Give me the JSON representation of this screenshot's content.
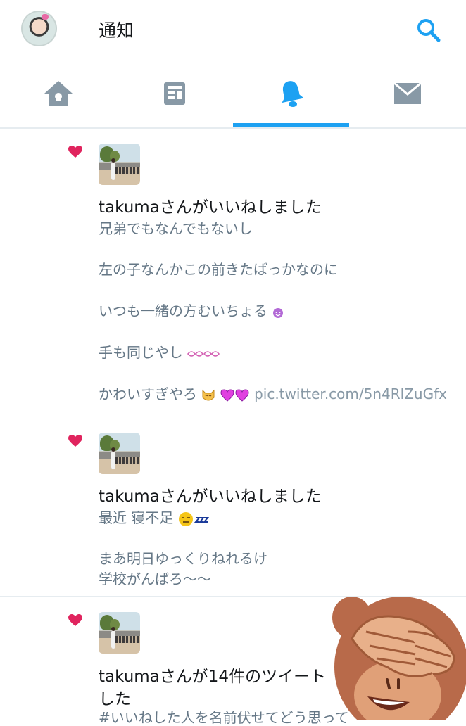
{
  "header": {
    "title": "通知"
  },
  "tabs": [
    {
      "name": "home"
    },
    {
      "name": "moments"
    },
    {
      "name": "notifications",
      "active": true
    },
    {
      "name": "messages"
    }
  ],
  "colors": {
    "accent": "#1da1f2",
    "heart": "#e0245e",
    "secondary_text": "#657786"
  },
  "notifications": [
    {
      "headline": "takumaさんがいいねしました",
      "lines": [
        "兄弟でもなんでもないし",
        "左の子なんかこの前きたばっかなのに",
        "いつも一緒の方むいちょる",
        "手も同じやし",
        "かわいすぎやろ"
      ],
      "link": "pic.twitter.com/5n4RlZuGfx"
    },
    {
      "headline": "takumaさんがいいねしました",
      "lines": [
        "最近 寝不足",
        "まあ明日ゆっくりねれるけ",
        "学校がんばろ〜〜"
      ]
    },
    {
      "headline_line1": "takumaさんが14件のツイート",
      "headline_line2": "した",
      "lines": [
        "#いいねした人を名前伏せてどう思って"
      ]
    }
  ]
}
